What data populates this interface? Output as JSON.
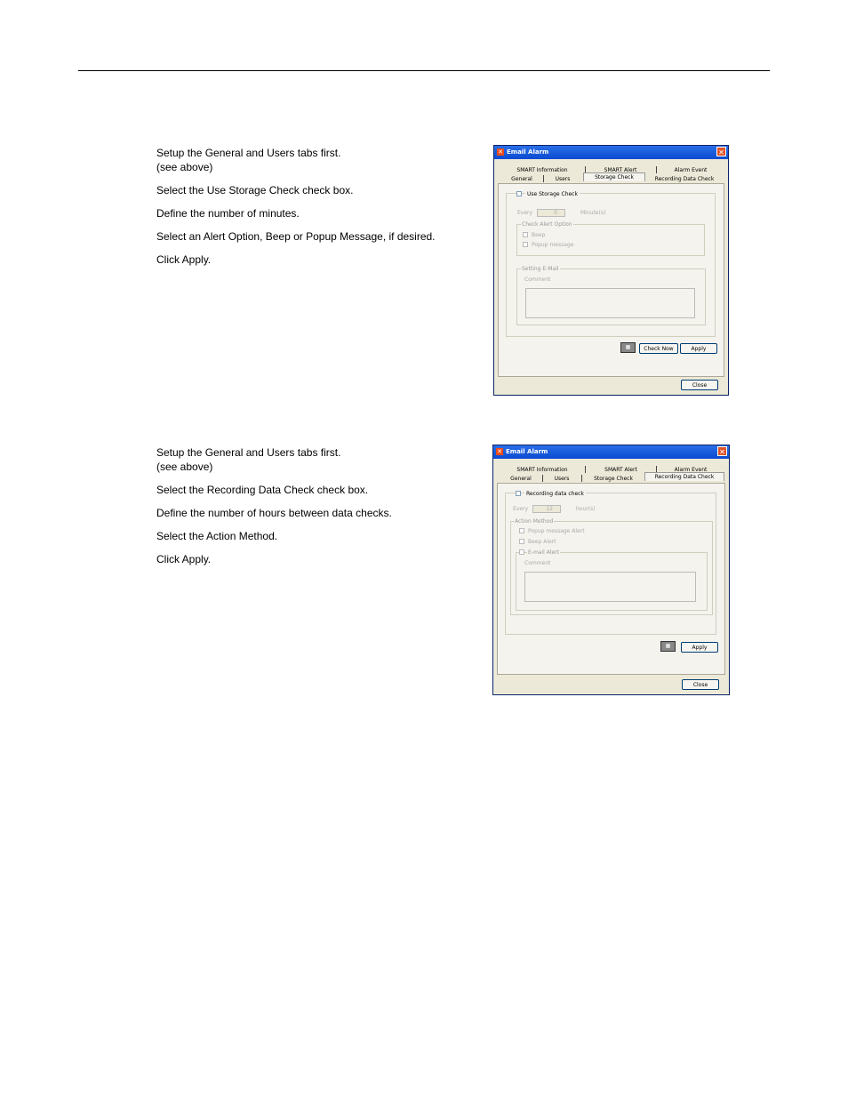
{
  "doc": {
    "steps1": [
      "Setup the General and Users tabs first.",
      "(see above)",
      "Select the Use Storage Check check box.",
      "Define the number of minutes.",
      "Select an Alert Option, Beep or Popup Message, if desired.",
      "Click Apply."
    ],
    "steps2": [
      "Setup the General and Users tabs first.",
      "(see above)",
      "Select the Recording Data Check check box.",
      "Define the number of hours between data checks.",
      "Select the Action Method.",
      "Click Apply."
    ]
  },
  "win1": {
    "title": "Email Alarm",
    "tabs_top": [
      "SMART Information",
      "SMART Alert",
      "Alarm Event"
    ],
    "tabs_bottom": [
      "General",
      "Users",
      "Storage Check",
      "Recording Data Check"
    ],
    "use_check": "Use Storage Check",
    "every": "Every",
    "every_value": "0",
    "minutes": "Minute(s)",
    "check_alert_group": "Check Alert Option",
    "beep": "Beep",
    "popup": "Popup message",
    "email_group": "Setting E-Mail",
    "comment": "Comment",
    "check_now": "Check Now",
    "apply": "Apply",
    "close": "Close"
  },
  "win2": {
    "title": "Email Alarm",
    "tabs_top": [
      "SMART Information",
      "SMART Alert",
      "Alarm Event"
    ],
    "tabs_bottom": [
      "General",
      "Users",
      "Storage Check",
      "Recording Data Check"
    ],
    "rec_check": "Recording data check",
    "every": "Every",
    "every_value": "12",
    "hours": "hour(s)",
    "action_group": "Action Method",
    "popup_alert": "Popup message Alert",
    "beep_alert": "Beep Alert",
    "email_alert": "E-mail Alert",
    "comment": "Comment",
    "apply": "Apply",
    "close": "Close"
  }
}
